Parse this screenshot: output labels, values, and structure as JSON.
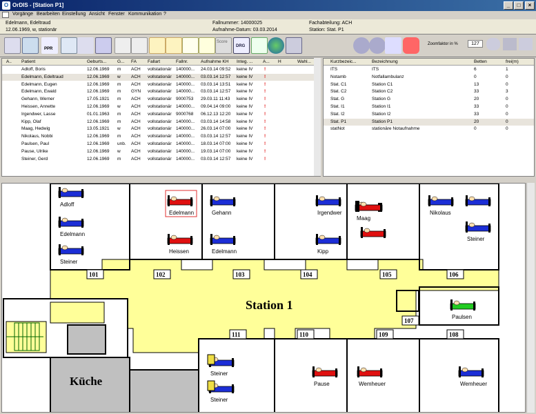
{
  "window": {
    "title": "OrDIS - [Station P1]",
    "min": "_",
    "max": "□",
    "close": "×"
  },
  "menu": [
    "Vorgänge",
    "Bearbeiten",
    "Einstellung",
    "Ansicht",
    "Fenster",
    "Kommunikation",
    "?"
  ],
  "patient_info": {
    "name": "Edelmann, Edeltraud",
    "details": "12.06.1969, w, stationär",
    "fallnummer": "Fallnummer: 14000025",
    "aufnahme": "Aufnahme-Datum: 03.03.2014",
    "fachabteilung": "Fachabteilung: ACH",
    "station": "Station: Stat. P1"
  },
  "toolbar": {
    "ppr": "PPR",
    "drg": "DRG",
    "score": "Score",
    "zoom_label": "Zoomfaktor in %",
    "zoom_value": "127"
  },
  "patients_table": {
    "headers": [
      "A..",
      "Patient",
      "Geburts...",
      "G...",
      "FA",
      "Fallart",
      "Fallnr.",
      "Aufnahme KH",
      "Integ. ...",
      "A...",
      "H",
      "Wahl..."
    ],
    "rows": [
      [
        "Adloff, Boris",
        "12.06.1969",
        "m",
        "ACH",
        "vollstationär",
        "140000...",
        "24.03.14 09:52",
        "keine IV"
      ],
      [
        "Edelmann, Edeltraud",
        "12.06.1969",
        "w",
        "ACH",
        "vollstationär",
        "140000...",
        "03.03.14 12:57",
        "keine IV"
      ],
      [
        "Edelmann, Eugen",
        "12.06.1969",
        "m",
        "ACH",
        "vollstationär",
        "140000...",
        "03.03.14 13:51",
        "keine IV"
      ],
      [
        "Edelmann, Ewald",
        "12.06.1969",
        "m",
        "GYN",
        "vollstationär",
        "140000...",
        "03.03.14 12:57",
        "keine IV"
      ],
      [
        "Gehann, Werner",
        "17.05.1921",
        "m",
        "ACH",
        "vollstationär",
        "9000753",
        "29.03.11 11:43",
        "keine IV"
      ],
      [
        "Heissen, Annette",
        "12.06.1969",
        "w",
        "ACH",
        "vollstationär",
        "140000...",
        "09.04.14 09:00",
        "keine IV"
      ],
      [
        "Irgendwer, Lasse",
        "01.01.1963",
        "m",
        "ACH",
        "vollstationär",
        "9000768",
        "06.12.13 12:20",
        "keine IV"
      ],
      [
        "Kipp, Olaf",
        "12.06.1969",
        "m",
        "ACH",
        "vollstationär",
        "140000...",
        "03.03.14 14:58",
        "keine IV"
      ],
      [
        "Maag, Hedwig",
        "13.05.1921",
        "w",
        "ACH",
        "vollstationär",
        "140000...",
        "26.03.14 07:00",
        "keine IV"
      ],
      [
        "Nikolaus, Nobbi",
        "12.06.1969",
        "m",
        "ACH",
        "vollstationär",
        "140000...",
        "03.03.14 12:57",
        "keine IV"
      ],
      [
        "Paulsen, Paul",
        "12.06.1969",
        "unb.",
        "ACH",
        "vollstationär",
        "140000...",
        "18.03.14 07:00",
        "keine IV"
      ],
      [
        "Pause, Ulrike",
        "12.06.1969",
        "w",
        "ACH",
        "vollstationär",
        "140000...",
        "19.03.14 07:00",
        "keine IV"
      ],
      [
        "Steiner, Gerd",
        "12.06.1969",
        "m",
        "ACH",
        "vollstationär",
        "140000...",
        "03.03.14 12:57",
        "keine IV"
      ]
    ]
  },
  "stations_table": {
    "headers": [
      "Kurzbezeic...",
      "Bezeichnung",
      "Betten",
      "frei(m)"
    ],
    "rows": [
      [
        "ITS",
        "ITS",
        "6",
        "1"
      ],
      [
        "Notamb",
        "Notfallambulanz",
        "0",
        "0"
      ],
      [
        "Stat. C1",
        "Station C1",
        "13",
        "0"
      ],
      [
        "Stat. C2",
        "Station C2",
        "33",
        "3"
      ],
      [
        "Stat. G",
        "Station G",
        "20",
        "0"
      ],
      [
        "Stat. I1",
        "Station I1",
        "33",
        "0"
      ],
      [
        "Stat. I2",
        "Station I2",
        "33",
        "0"
      ],
      [
        "Stat. P1",
        "Station P1",
        "20",
        "0"
      ],
      [
        "statNot",
        "stationäre Notaufnahme",
        "0",
        "0"
      ]
    ]
  },
  "plan": {
    "station_label": "Station 1",
    "kitchen_label": "Küche",
    "rooms": [
      "101",
      "102",
      "103",
      "104",
      "105",
      "106",
      "107",
      "111",
      "110",
      "109",
      "108"
    ],
    "bed_names": [
      "Adloff",
      "Edelmann",
      "Steiner",
      "Edelmann",
      "Heissen",
      "Gehann",
      "Edelmann",
      "Irgendwer",
      "Kipp",
      "Maag",
      "Nikolaus",
      "Steiner",
      "Paulsen",
      "Steiner",
      "Steiner",
      "Pause",
      "Wemheuer",
      "Wemheuer"
    ]
  },
  "colors": {
    "corridor": "#ffff99",
    "bed_blue": "#1c2ed6",
    "bed_red": "#e01010",
    "bed_green": "#22cc22",
    "gray_room": "#c0c0c0"
  }
}
